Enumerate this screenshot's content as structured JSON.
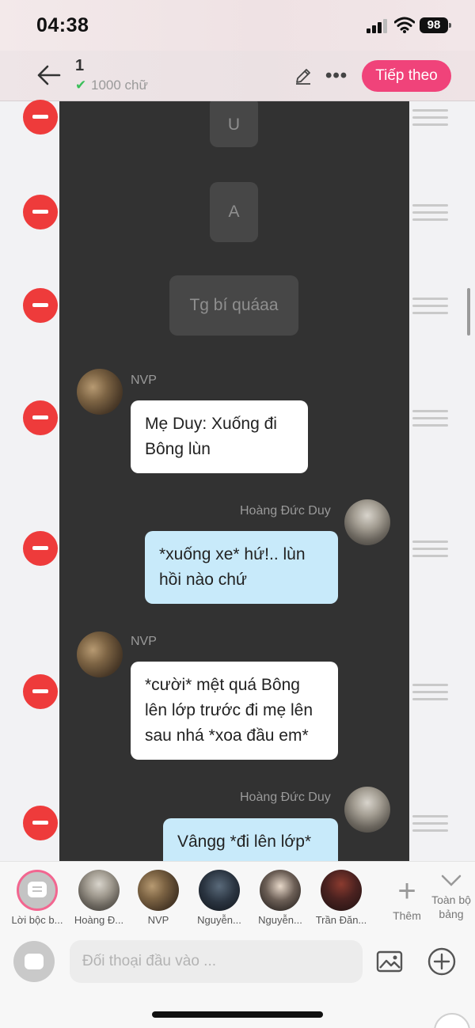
{
  "status": {
    "time": "04:38",
    "battery": "98"
  },
  "header": {
    "title": "1",
    "word_count": "1000 chữ",
    "next_label": "Tiếp theo",
    "accent": "#f0437a"
  },
  "messages": {
    "sys1": "U",
    "sys2": "A",
    "sys3": "Tg bí quáaa",
    "m1": {
      "sender": "NVP",
      "text": "Mẹ Duy: Xuống đi Bông lùn"
    },
    "m2": {
      "sender": "Hoàng Đức Duy",
      "text": "*xuống xe* hứ!.. lùn hồi nào chứ"
    },
    "m3": {
      "sender": "NVP",
      "text": "*cười* mệt quá Bông lên lớp trước đi mẹ lên sau nhá *xoa đầu em*"
    },
    "m4": {
      "sender": "Hoàng Đức Duy",
      "text": "Vângg *đi lên lớp*"
    }
  },
  "characters": {
    "narration": "Lời bộc b...",
    "c1": "Hoàng Đ...",
    "c2": "NVP",
    "c3": "Nguyễn...",
    "c4": "Nguyễn...",
    "c5": "Trần Đăn...",
    "add_more": "Thêm",
    "full_table": "Toàn bộ bảng"
  },
  "input": {
    "placeholder": "Đối thoại đầu vào ..."
  }
}
